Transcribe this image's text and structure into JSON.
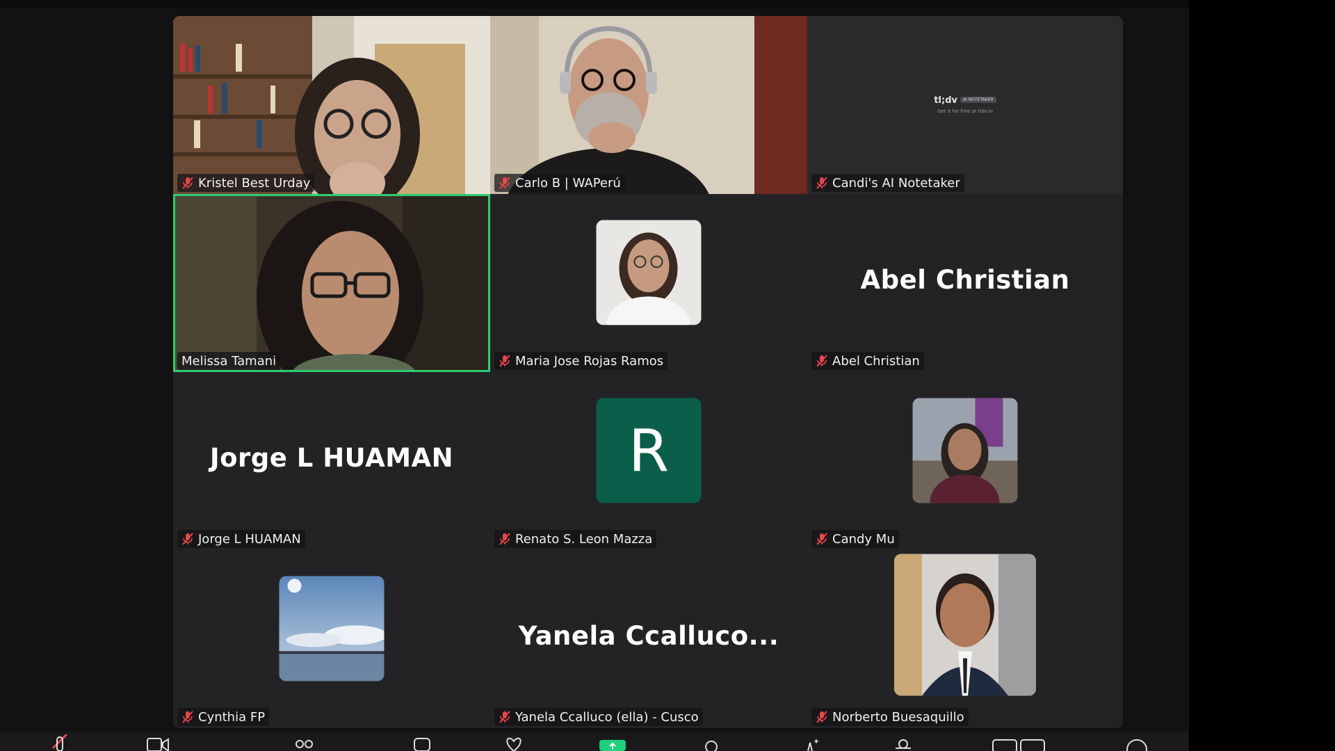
{
  "meeting": {
    "participants": [
      {
        "name": "Kristel Best Urday",
        "type": "video",
        "muted": true
      },
      {
        "name": "Carlo B | WAPerú",
        "type": "video",
        "muted": true
      },
      {
        "name": "Candi's AI Notetaker",
        "type": "tldv",
        "muted": true
      },
      {
        "name": "Melissa Tamani",
        "type": "video",
        "muted": false,
        "active_speaker": true
      },
      {
        "name": "Maria Jose Rojas Ramos",
        "type": "photo-avatar",
        "muted": true
      },
      {
        "name": "Abel Christian",
        "type": "name-only",
        "display": "Abel Christian",
        "muted": true
      },
      {
        "name": "Jorge L HUAMAN",
        "type": "name-only",
        "display": "Jorge L HUAMAN",
        "muted": true
      },
      {
        "name": "Renato S. Leon Mazza",
        "type": "letter-avatar",
        "letter": "R",
        "muted": true
      },
      {
        "name": "Candy Mu",
        "type": "photo-avatar",
        "muted": true
      },
      {
        "name": "Cynthia FP",
        "type": "photo-avatar",
        "muted": true
      },
      {
        "name": "Yanela Ccalluco (ella) - Cusco",
        "type": "name-only",
        "display": "Yanela  Ccalluco...",
        "muted": true
      },
      {
        "name": "Norberto Buesaquillo",
        "type": "photo-avatar",
        "muted": true
      }
    ],
    "tldv": {
      "logo": "tl;dv",
      "badge": "AI NOTETAKER",
      "sub": "Get it for free at tldv.io"
    }
  },
  "toolbar": {
    "buttons": [
      "mic-off-icon",
      "video-icon",
      "participants-icon",
      "chat-icon",
      "reactions-icon",
      "share-screen-icon",
      "record-icon",
      "ai-companion-icon",
      "apps-icon",
      "view-icon",
      "more-icon"
    ]
  },
  "colors": {
    "active_speaker": "#2ecc71",
    "tile_bg": "#232325",
    "muted_icon": "#e8474b",
    "avatar_letter_bg": "#0b5e4a",
    "share_button": "#1fcf7a"
  }
}
